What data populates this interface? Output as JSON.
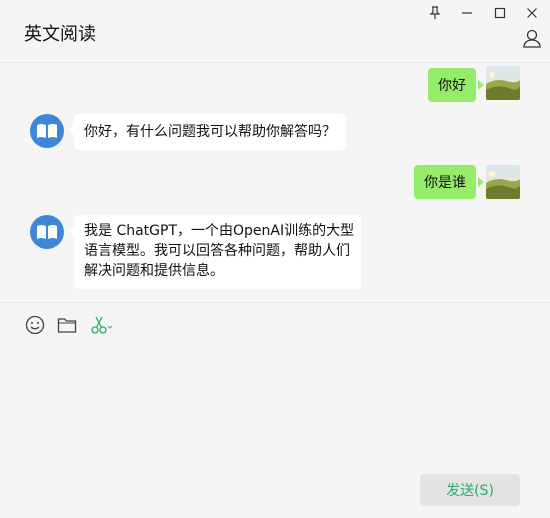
{
  "window": {
    "title": "英文阅读",
    "controls": [
      "pin-icon",
      "minimize-icon",
      "maximize-icon",
      "close-icon"
    ],
    "user_icon": "user-icon"
  },
  "messages": [
    {
      "sender": "me",
      "text": "你好",
      "avatar": "landscape-photo"
    },
    {
      "sender": "bot",
      "text": "你好，有什么问题我可以帮助你解答吗？",
      "avatar": "book-icon"
    },
    {
      "sender": "me",
      "text": "你是谁",
      "avatar": "landscape-photo"
    },
    {
      "sender": "bot",
      "lines": [
        "我是 ChatGPT，一个由OpenAI训练的大型",
        "语言模型。我可以回答各种问题，帮助人们",
        "解决问题和提供信息。"
      ],
      "avatar": "book-icon"
    }
  ],
  "toolbar": {
    "icons": [
      "emoji-icon",
      "folder-icon",
      "scissors-icon"
    ]
  },
  "input": {
    "value": ""
  },
  "send_button": {
    "label": "发送(S)"
  },
  "colors": {
    "background": "#f5f5f5",
    "my_bubble": "#95ec69",
    "bot_bubble": "#ffffff",
    "bot_avatar": "#3f87d6",
    "send_text": "#23b26b",
    "send_bg": "#e3e3e3"
  }
}
